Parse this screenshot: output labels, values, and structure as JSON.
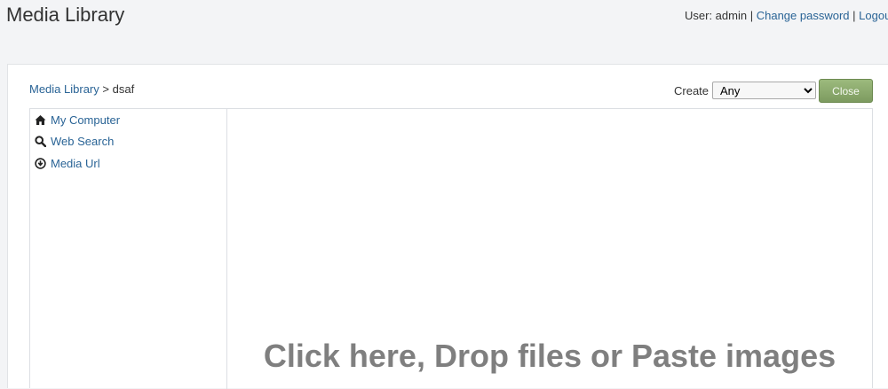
{
  "header": {
    "title": "Media Library",
    "user_prefix": "User: admin",
    "separator": "|",
    "change_password": "Change password",
    "logout": "Logout"
  },
  "breadcrumb": {
    "root": "Media Library",
    "separator": ">",
    "current": "dsaf"
  },
  "toolbar": {
    "create_label": "Create",
    "create_selected": "Any",
    "close_label": "Close"
  },
  "sidebar": {
    "items": [
      {
        "label": "My Computer",
        "icon": "home-icon"
      },
      {
        "label": "Web Search",
        "icon": "search-icon"
      },
      {
        "label": "Media Url",
        "icon": "download-circle-icon"
      }
    ]
  },
  "dropzone": {
    "text": "Click here, Drop files or Paste images"
  },
  "colors": {
    "link": "#2a6496",
    "close_button": "#8dab6f",
    "drop_text": "#7f7f7f"
  }
}
